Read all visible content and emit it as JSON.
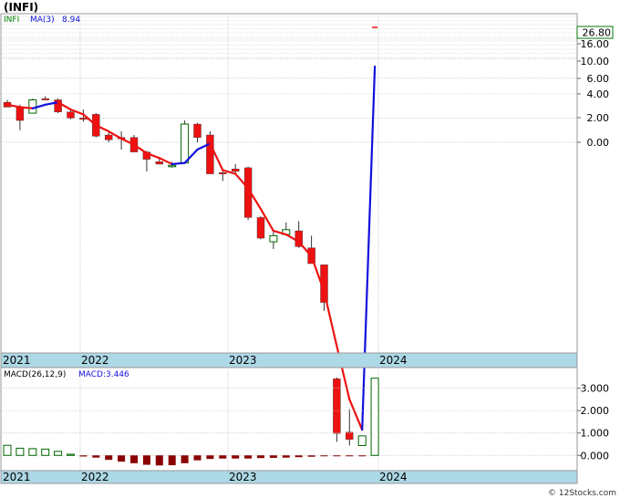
{
  "title": "(INFI)",
  "footer": "© 12Stocks.com",
  "price_panel": {
    "ticker_label": "INFI",
    "ma_label": "MA(3)",
    "ma_value": "8.94",
    "last_price_label": "26.80",
    "y_ticks": [
      "16.00",
      "10.00",
      "6.00",
      "4.00",
      "2.00",
      "0.00"
    ]
  },
  "macd_panel": {
    "label": "MACD(26,12,9)",
    "value_label": "MACD:3.446",
    "y_ticks": [
      "3.000",
      "2.000",
      "1.000",
      "0.000"
    ]
  },
  "x_years": [
    "2021",
    "2022",
    "2023",
    "2024"
  ],
  "colors": {
    "up_fill": "#ffffff",
    "up_border": "#006400",
    "down": "#ee1111",
    "ma_down": "#ee1111",
    "ma_up": "#1010dd",
    "axis_band": "#add8e6",
    "macd_pos_border": "#006400",
    "macd_pos_fill": "#ffffff",
    "macd_neg": "#8b0000",
    "grid": "#c8c8c8"
  },
  "chart_data": [
    {
      "type": "candlestick",
      "period": "monthly",
      "ticks": [
        16,
        10,
        6,
        4,
        2,
        0
      ],
      "candles": [
        {
          "o": 3.3,
          "h": 3.5,
          "l": 2.9,
          "c": 2.9
        },
        {
          "o": 2.9,
          "h": 3.1,
          "l": 1.0,
          "c": 1.8
        },
        {
          "o": 2.4,
          "h": 3.6,
          "l": 2.4,
          "c": 3.5
        },
        {
          "o": 3.6,
          "h": 3.8,
          "l": 3.5,
          "c": 3.5
        },
        {
          "o": 3.5,
          "h": 3.6,
          "l": 2.4,
          "c": 2.5
        },
        {
          "o": 2.5,
          "h": 2.8,
          "l": 1.9,
          "c": 2.0
        },
        {
          "o": 2.0,
          "h": 2.7,
          "l": 1.7,
          "c": 1.9
        },
        {
          "o": 2.3,
          "h": 2.4,
          "l": 0.4,
          "c": 0.5
        },
        {
          "o": 0.6,
          "h": 0.8,
          "l": 0.0,
          "c": 0.2
        },
        {
          "o": 0.4,
          "h": 0.9,
          "l": -0.6,
          "c": 0.3
        },
        {
          "o": 0.4,
          "h": 0.6,
          "l": -0.8,
          "c": -0.8
        },
        {
          "o": -0.8,
          "h": -0.7,
          "l": -2.4,
          "c": -1.4
        },
        {
          "o": -1.6,
          "h": -1.2,
          "l": -1.8,
          "c": -1.8
        },
        {
          "o": -1.9,
          "h": -1.6,
          "l": -2.1,
          "c": -1.9
        },
        {
          "o": -1.7,
          "h": 1.8,
          "l": -1.7,
          "c": 1.5
        },
        {
          "o": 1.5,
          "h": 1.6,
          "l": 0.0,
          "c": 0.4
        },
        {
          "o": 0.6,
          "h": 0.9,
          "l": -2.6,
          "c": -2.6
        },
        {
          "o": -2.5,
          "h": -2.4,
          "l": -3.2,
          "c": -2.6
        },
        {
          "o": -2.2,
          "h": -1.8,
          "l": -2.7,
          "c": -2.4
        },
        {
          "o": -2.1,
          "h": -2.0,
          "l": -6.4,
          "c": -6.2
        },
        {
          "o": -6.2,
          "h": -6.1,
          "l": -8.0,
          "c": -7.9
        },
        {
          "o": -8.2,
          "h": -7.4,
          "l": -8.8,
          "c": -7.7
        },
        {
          "o": -7.6,
          "h": -6.6,
          "l": -7.7,
          "c": -7.2
        },
        {
          "o": -7.3,
          "h": -6.5,
          "l": -8.7,
          "c": -8.6
        },
        {
          "o": -8.7,
          "h": -7.7,
          "l": -9.9,
          "c": -10.0
        },
        {
          "o": -10.1,
          "h": -10.1,
          "l": -13.9,
          "c": -13.2
        },
        {
          "o": -19.5,
          "h": -19.4,
          "l": -24.7,
          "c": -24.0
        },
        {
          "o": -23.9,
          "h": -22.0,
          "l": -25.0,
          "c": -24.5
        },
        {
          "o": -25.0,
          "h": -24.2,
          "l": -25.0,
          "c": -24.2
        }
      ],
      "last_close": 26.8,
      "ma3": [
        3.1,
        2.9,
        2.8,
        3.1,
        3.3,
        2.7,
        2.3,
        1.4,
        0.9,
        0.3,
        -0.2,
        -0.9,
        -1.3,
        -1.8,
        -1.7,
        -0.6,
        -0.1,
        -2.3,
        -2.6,
        -3.8,
        -5.5,
        -7.3,
        -7.6,
        -8.2,
        -9.4,
        -12.3,
        -16.8,
        -21.2,
        -23.7,
        8.94
      ]
    },
    {
      "type": "bar",
      "title": "MACD(26,12,9)",
      "ylim": [
        -0.6,
        3.8
      ],
      "values": [
        0.45,
        0.32,
        0.3,
        0.28,
        0.18,
        0.05,
        -0.05,
        -0.1,
        -0.2,
        -0.28,
        -0.35,
        -0.42,
        -0.45,
        -0.44,
        -0.35,
        -0.22,
        -0.16,
        -0.14,
        -0.14,
        -0.14,
        -0.12,
        -0.11,
        -0.1,
        -0.08,
        -0.06,
        -0.04,
        -0.02,
        -0.01,
        -0.01,
        3.446
      ]
    }
  ]
}
